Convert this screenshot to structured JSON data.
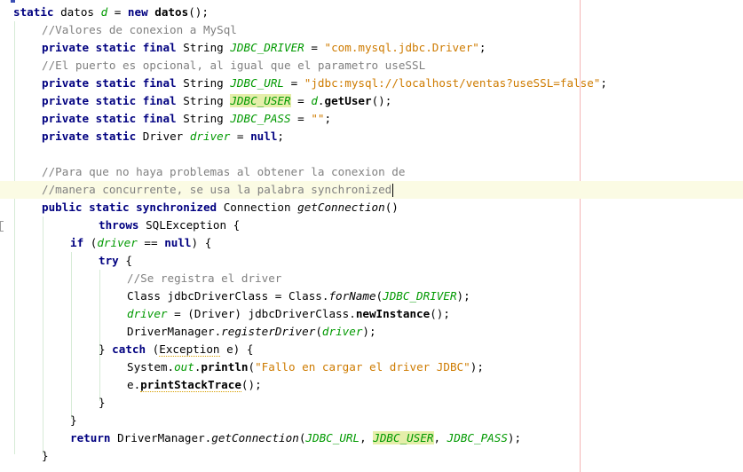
{
  "editor": {
    "language": "Java",
    "lines": [
      {
        "id": "l1",
        "indent": 1,
        "tokens": [
          {
            "t": "static",
            "c": "kw"
          },
          {
            "t": " datos "
          },
          {
            "t": "d",
            "c": "fld"
          },
          {
            "t": " = "
          },
          {
            "t": "new",
            "c": "kw"
          },
          {
            "t": " "
          },
          {
            "t": "datos",
            "c": "mthb"
          },
          {
            "t": "();"
          }
        ]
      },
      {
        "id": "l2",
        "indent": 2,
        "tokens": [
          {
            "t": "//Valores de conexion a MySql",
            "c": "cm"
          }
        ]
      },
      {
        "id": "l3",
        "indent": 2,
        "tokens": [
          {
            "t": "private static final",
            "c": "kw"
          },
          {
            "t": " String "
          },
          {
            "t": "JDBC_DRIVER",
            "c": "sfld"
          },
          {
            "t": " = "
          },
          {
            "t": "\"com.mysql.jdbc.Driver\"",
            "c": "st"
          },
          {
            "t": ";"
          }
        ]
      },
      {
        "id": "l4",
        "indent": 2,
        "tokens": [
          {
            "t": "//El puerto es opcional, al igual que el parametro useSSL",
            "c": "cm"
          }
        ]
      },
      {
        "id": "l5",
        "indent": 2,
        "tokens": [
          {
            "t": "private static final",
            "c": "kw"
          },
          {
            "t": " String "
          },
          {
            "t": "JDBC_URL",
            "c": "sfld"
          },
          {
            "t": " = "
          },
          {
            "t": "\"jdbc:mysql://localhost/ventas?useSSL=false\"",
            "c": "st"
          },
          {
            "t": ";"
          }
        ]
      },
      {
        "id": "l6",
        "indent": 2,
        "tokens": [
          {
            "t": "private static final",
            "c": "kw"
          },
          {
            "t": " String "
          },
          {
            "t": "JDBC_USER",
            "c": "sfld hl"
          },
          {
            "t": " = "
          },
          {
            "t": "d",
            "c": "fld"
          },
          {
            "t": "."
          },
          {
            "t": "getUser",
            "c": "mthb"
          },
          {
            "t": "();"
          }
        ]
      },
      {
        "id": "l7",
        "indent": 2,
        "tokens": [
          {
            "t": "private static final",
            "c": "kw"
          },
          {
            "t": " String "
          },
          {
            "t": "JDBC_PASS",
            "c": "sfld"
          },
          {
            "t": " = "
          },
          {
            "t": "\"\"",
            "c": "st"
          },
          {
            "t": ";"
          }
        ]
      },
      {
        "id": "l8",
        "indent": 2,
        "tokens": [
          {
            "t": "private static",
            "c": "kw"
          },
          {
            "t": " Driver "
          },
          {
            "t": "driver",
            "c": "fld"
          },
          {
            "t": " = "
          },
          {
            "t": "null",
            "c": "kw"
          },
          {
            "t": ";"
          }
        ]
      },
      {
        "id": "l9",
        "indent": 0,
        "tokens": []
      },
      {
        "id": "l10",
        "indent": 2,
        "tokens": [
          {
            "t": "//Para que no haya problemas al obtener la conexion de",
            "c": "cm"
          }
        ]
      },
      {
        "id": "l11",
        "indent": 2,
        "current": true,
        "caret": true,
        "tokens": [
          {
            "t": "//manera concurrente, se usa la palabra synchronized",
            "c": "cm"
          }
        ]
      },
      {
        "id": "l12",
        "indent": 2,
        "tokens": [
          {
            "t": "public static synchronized",
            "c": "kw"
          },
          {
            "t": " Connection "
          },
          {
            "t": "getConnection",
            "c": "mth"
          },
          {
            "t": "()"
          }
        ]
      },
      {
        "id": "l13",
        "indent": 4,
        "tokens": [
          {
            "t": "throws",
            "c": "kw"
          },
          {
            "t": " SQLException {"
          }
        ]
      },
      {
        "id": "l14",
        "indent": 3,
        "tokens": [
          {
            "t": "if",
            "c": "kw"
          },
          {
            "t": " ("
          },
          {
            "t": "driver",
            "c": "fld"
          },
          {
            "t": " == "
          },
          {
            "t": "null",
            "c": "kw"
          },
          {
            "t": ") {"
          }
        ]
      },
      {
        "id": "l15",
        "indent": 4,
        "tokens": [
          {
            "t": "try",
            "c": "kw"
          },
          {
            "t": " {"
          }
        ]
      },
      {
        "id": "l16",
        "indent": 5,
        "tokens": [
          {
            "t": "//Se registra el driver",
            "c": "cm"
          }
        ]
      },
      {
        "id": "l17",
        "indent": 5,
        "tokens": [
          {
            "t": "Class jdbcDriverClass = Class."
          },
          {
            "t": "forName",
            "c": "mth"
          },
          {
            "t": "("
          },
          {
            "t": "JDBC_DRIVER",
            "c": "sfld"
          },
          {
            "t": ");"
          }
        ]
      },
      {
        "id": "l18",
        "indent": 5,
        "tokens": [
          {
            "t": "driver",
            "c": "fld"
          },
          {
            "t": " = (Driver) jdbcDriverClass."
          },
          {
            "t": "newInstance",
            "c": "mthb"
          },
          {
            "t": "();"
          }
        ]
      },
      {
        "id": "l19",
        "indent": 5,
        "tokens": [
          {
            "t": "DriverManager."
          },
          {
            "t": "registerDriver",
            "c": "mth"
          },
          {
            "t": "("
          },
          {
            "t": "driver",
            "c": "fld"
          },
          {
            "t": ");"
          }
        ]
      },
      {
        "id": "l20",
        "indent": 4,
        "tokens": [
          {
            "t": "} "
          },
          {
            "t": "catch",
            "c": "kw"
          },
          {
            "t": " ("
          },
          {
            "t": "Exception",
            "c": "warn"
          },
          {
            "t": " e) {"
          }
        ]
      },
      {
        "id": "l21",
        "indent": 5,
        "tokens": [
          {
            "t": "System."
          },
          {
            "t": "out",
            "c": "sfld"
          },
          {
            "t": "."
          },
          {
            "t": "println",
            "c": "mthb"
          },
          {
            "t": "("
          },
          {
            "t": "\"Fallo en cargar el driver JDBC\"",
            "c": "st"
          },
          {
            "t": ");"
          }
        ]
      },
      {
        "id": "l22",
        "indent": 5,
        "tokens": [
          {
            "t": "e."
          },
          {
            "t": "printStackTrace",
            "c": "mthb warn"
          },
          {
            "t": "();"
          }
        ]
      },
      {
        "id": "l23",
        "indent": 4,
        "tokens": [
          {
            "t": "}"
          }
        ]
      },
      {
        "id": "l24",
        "indent": 3,
        "tokens": [
          {
            "t": "}"
          }
        ]
      },
      {
        "id": "l25",
        "indent": 3,
        "tokens": [
          {
            "t": "return",
            "c": "kw"
          },
          {
            "t": " DriverManager."
          },
          {
            "t": "getConnection",
            "c": "mth"
          },
          {
            "t": "("
          },
          {
            "t": "JDBC_URL",
            "c": "sfld"
          },
          {
            "t": ", "
          },
          {
            "t": "JDBC_USER",
            "c": "sfld hl"
          },
          {
            "t": ", "
          },
          {
            "t": "JDBC_PASS",
            "c": "sfld"
          },
          {
            "t": ");"
          }
        ]
      },
      {
        "id": "l26",
        "indent": 2,
        "tokens": [
          {
            "t": "}"
          }
        ]
      }
    ]
  },
  "colors": {
    "keyword": "#000080",
    "comment": "#808080",
    "string": "#ce7b00",
    "field": "#009900",
    "highlight": "#e5eeaa",
    "current_line": "#fbfbe4",
    "right_margin": "#f5b6b6"
  }
}
